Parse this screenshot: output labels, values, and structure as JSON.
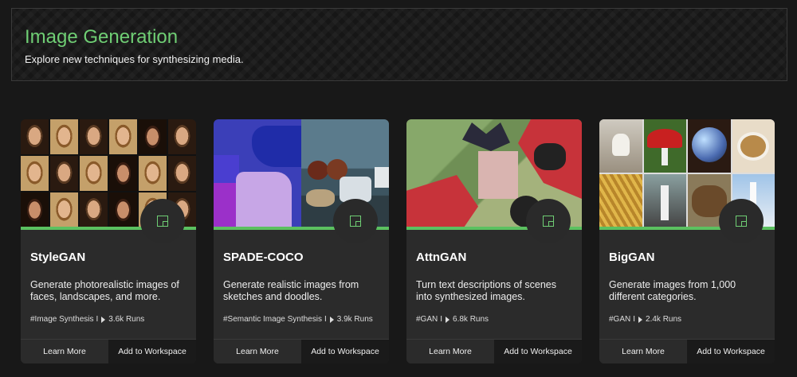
{
  "hero": {
    "title": "Image Generation",
    "subtitle": "Explore new techniques for synthesizing media."
  },
  "colors": {
    "accent": "#6fce74",
    "card_bg": "#2b2b2b",
    "page_bg": "#181818"
  },
  "cards": [
    {
      "title": "StyleGAN",
      "description": "Generate photorealistic images of faces, landscapes, and more.",
      "tag": "#Image Synthesis",
      "runs": "3.6k Runs",
      "learn_more": "Learn More",
      "add_to_workspace": "Add to Workspace"
    },
    {
      "title": "SPADE-COCO",
      "description": "Generate realistic images from sketches and doodles.",
      "tag": "#Semantic Image Synthesis",
      "runs": "3.9k Runs",
      "learn_more": "Learn More",
      "add_to_workspace": "Add to Workspace"
    },
    {
      "title": "AttnGAN",
      "description": "Turn text descriptions of scenes into synthesized images.",
      "tag": "#GAN",
      "runs": "6.8k Runs",
      "learn_more": "Learn More",
      "add_to_workspace": "Add to Workspace"
    },
    {
      "title": "BigGAN",
      "description": "Generate images from 1,000 different categories.",
      "tag": "#GAN",
      "runs": "2.4k Runs",
      "learn_more": "Learn More",
      "add_to_workspace": "Add to Workspace"
    }
  ]
}
